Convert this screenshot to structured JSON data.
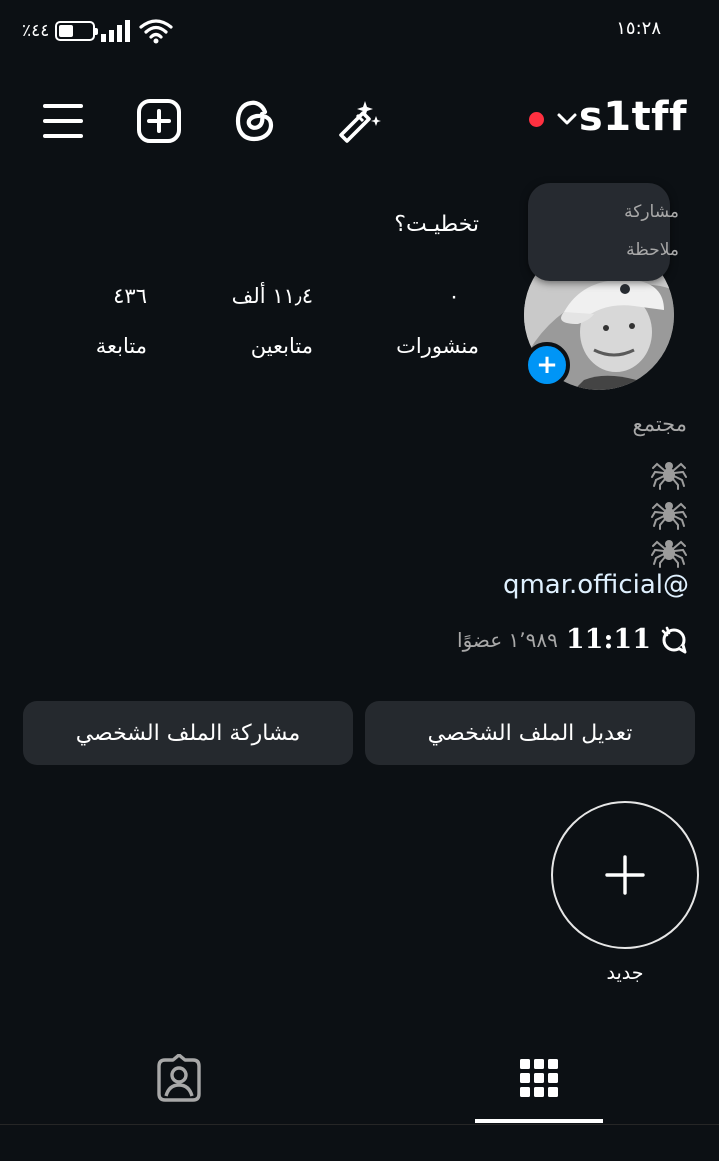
{
  "status_bar": {
    "battery_text": "٪٤٤",
    "battery_level": 0.44,
    "time": "١٥:٢٨",
    "icons": [
      "battery-icon",
      "signal-icon",
      "wifi-icon"
    ]
  },
  "header": {
    "username": "s1tff",
    "live_indicator_color": "#ff3040",
    "icons": [
      "menu-icon",
      "create-icon",
      "threads-icon",
      "ai-wand-icon",
      "chevron-down-icon"
    ]
  },
  "note": {
    "line1": "مشاركة",
    "line2": "ملاحظة"
  },
  "profile": {
    "display_name": "تخطيـت؟",
    "stats": [
      {
        "value": "٠",
        "label": "منشورات"
      },
      {
        "value": "١١٫٤ ألف",
        "label": "متابعين"
      },
      {
        "value": "٤٣٦",
        "label": "متابعة"
      }
    ]
  },
  "bio": {
    "category": "مجتمع",
    "spider_lines": 3,
    "link": "qmar.official@",
    "community_name": "11:11",
    "community_members": "١٬٩٨٩ عضوًا"
  },
  "buttons": {
    "edit_profile": "تعديل الملف الشخصي",
    "share_profile": "مشاركة الملف الشخصي"
  },
  "highlights": {
    "new_label": "جديد"
  },
  "tabs": {
    "icons": [
      "grid-icon",
      "tagged-icon"
    ],
    "active": "grid-icon"
  },
  "colors": {
    "background": "#0c1014",
    "button": "#25292e",
    "accent_blue": "#0095f6",
    "link": "#e0f1ff",
    "secondary_text": "#a8a8a8"
  }
}
